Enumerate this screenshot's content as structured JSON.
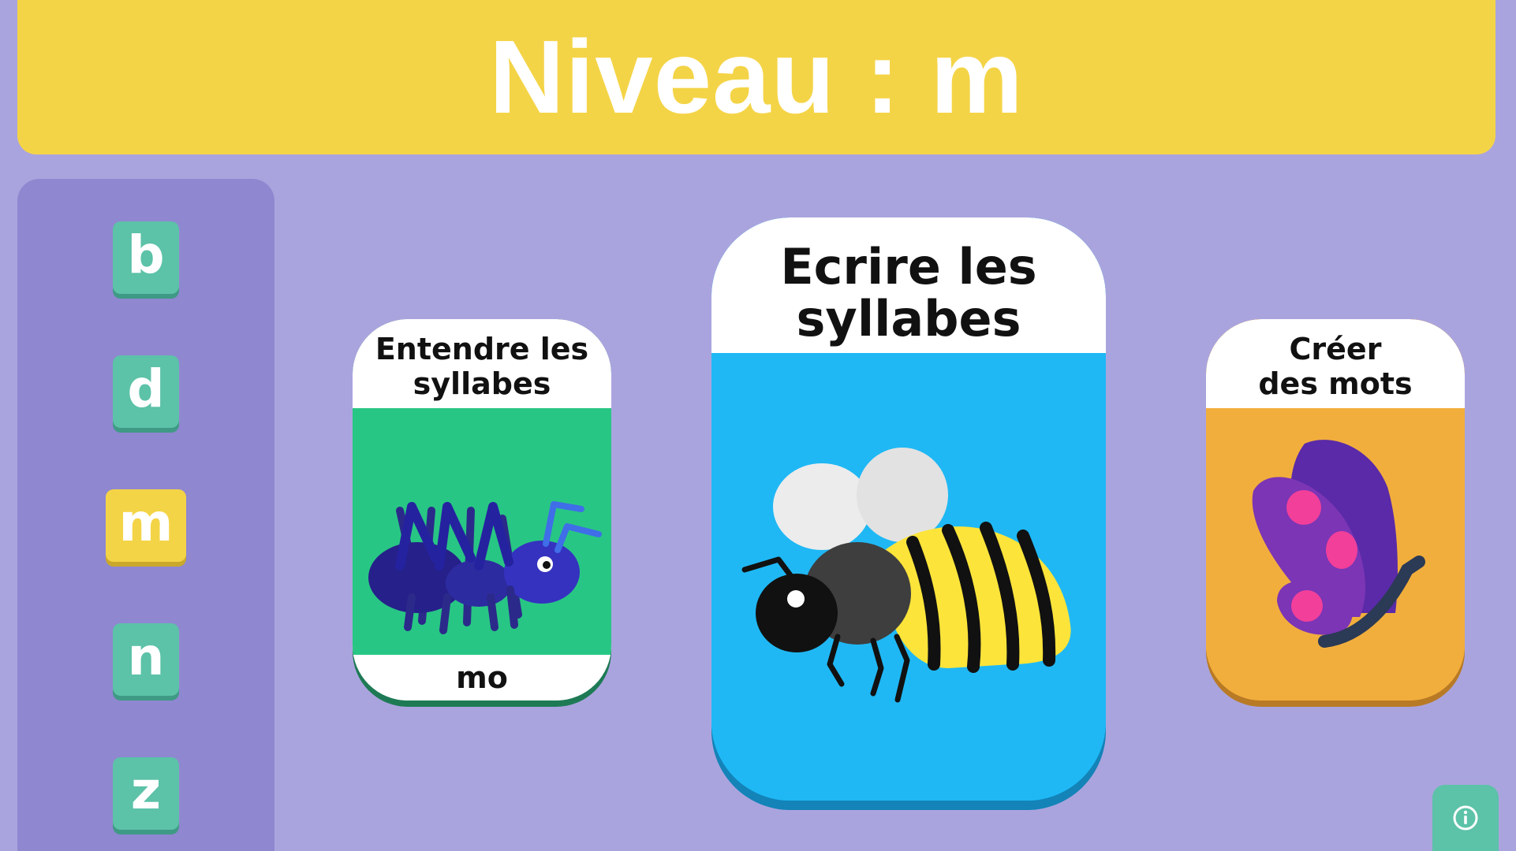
{
  "header": {
    "title": "Niveau : m"
  },
  "sidebar": {
    "letters": [
      {
        "label": "b"
      },
      {
        "label": "d"
      },
      {
        "label": "m",
        "selected": true
      },
      {
        "label": "n"
      },
      {
        "label": "z"
      }
    ]
  },
  "activities": {
    "hear": {
      "title_line1": "Entendre les",
      "title_line2": "syllabes",
      "syllable": "mo",
      "color": "#28c684",
      "icon": "ant-icon"
    },
    "write": {
      "title_line1": "Ecrire les",
      "title_line2": "syllabes",
      "color": "#1fb8f5",
      "icon": "bee-icon"
    },
    "create": {
      "title_line1": "Créer",
      "title_line2": "des mots",
      "color": "#f2ae3c",
      "icon": "butterfly-icon"
    }
  },
  "info_button": {
    "icon": "info-icon"
  },
  "colors": {
    "background": "#aaa4de",
    "header": "#f4d447",
    "sidebar": "#8f87d0",
    "letter_button": "#5cc2a8",
    "letter_selected": "#f4d447"
  }
}
